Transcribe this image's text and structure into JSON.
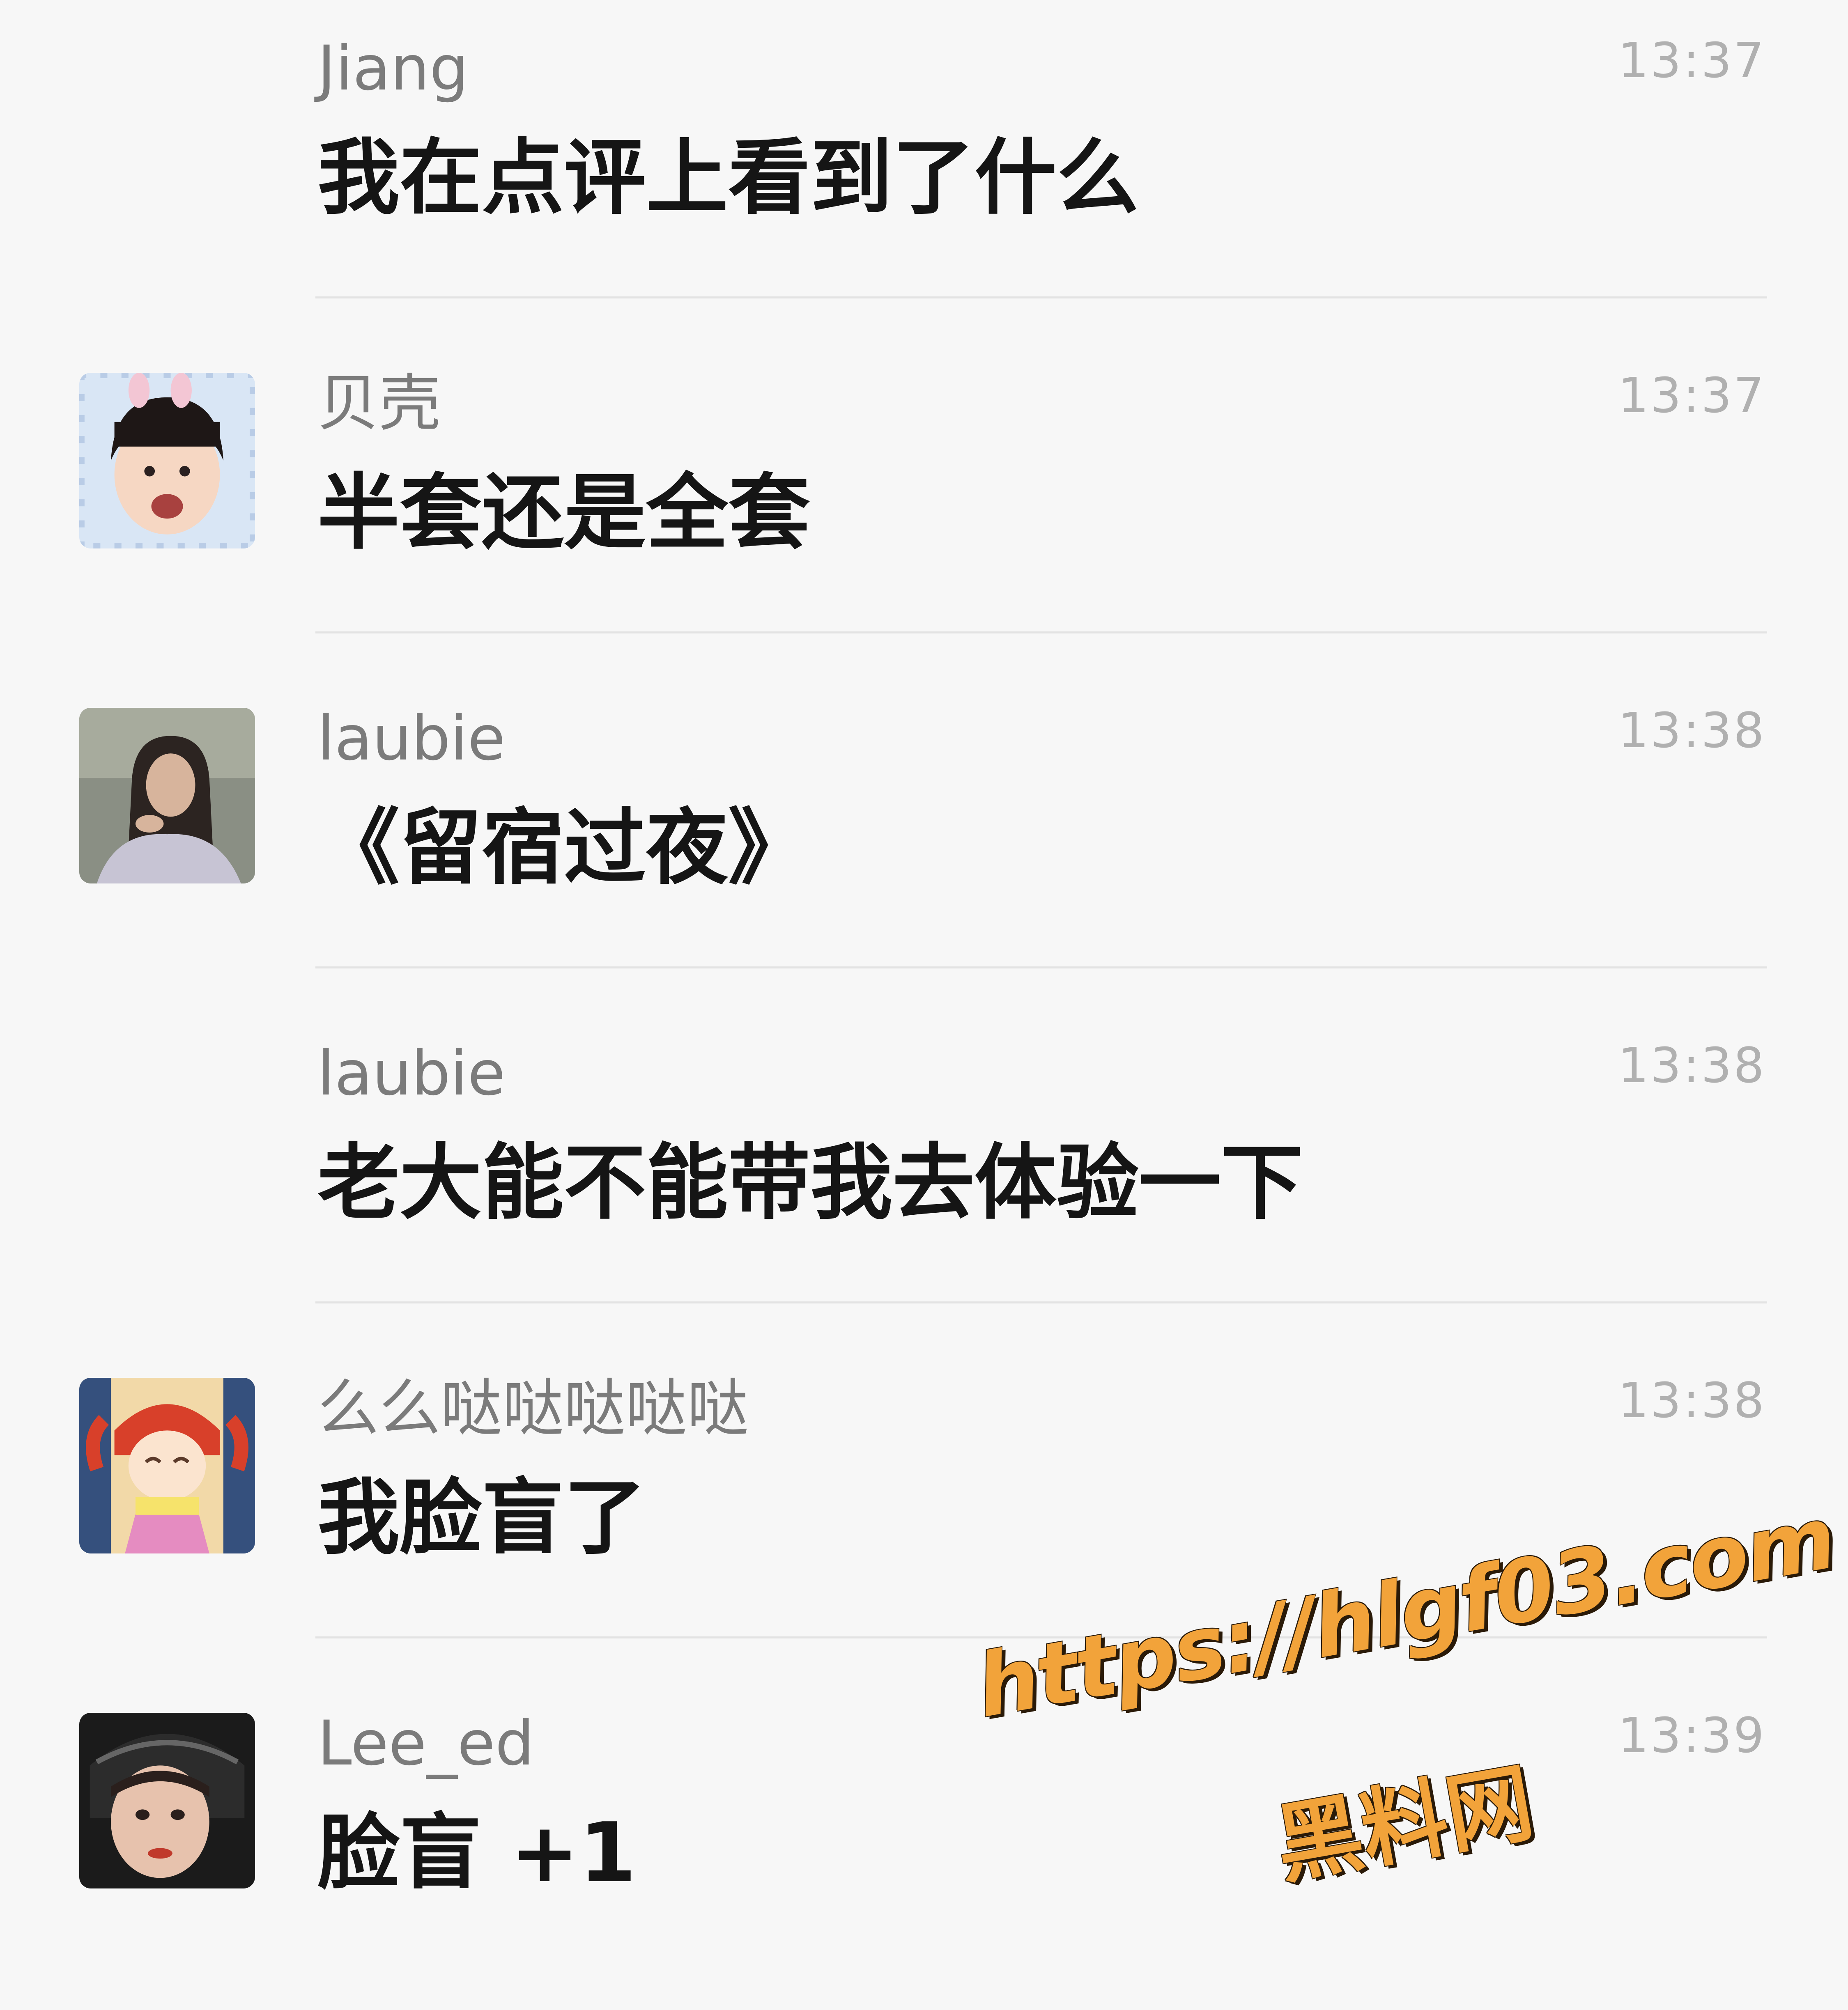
{
  "messages": [
    {
      "sender": "Jiang",
      "time": "13:37",
      "text": "我在点评上看到了什么",
      "avatar": "none"
    },
    {
      "sender": "贝壳",
      "time": "13:37",
      "text": "半套还是全套",
      "avatar": "toddler-bunny-ears-avatar"
    },
    {
      "sender": "laubie",
      "time": "13:38",
      "text": "《留宿过夜》",
      "avatar": "woman-portrait-avatar"
    },
    {
      "sender": "laubie",
      "time": "13:38",
      "text": "老大能不能带我去体验一下",
      "avatar": "none"
    },
    {
      "sender": "么么哒哒哒哒哒",
      "time": "13:38",
      "text": "我脸盲了",
      "avatar": "cartoon-girl-avatar"
    },
    {
      "sender": "Lee_ed",
      "time": "13:39",
      "text": "脸盲 +1",
      "avatar": "helmet-girl-avatar"
    }
  ],
  "watermark": {
    "url": "https://hlgf03.com",
    "name": "黑料网"
  },
  "colors": {
    "background": "#f7f7f7",
    "sender": "#7b7b7b",
    "timestamp": "#b0b0b0",
    "message": "#151515",
    "divider": "#e3e3e3",
    "watermark": "#f2a33a"
  }
}
